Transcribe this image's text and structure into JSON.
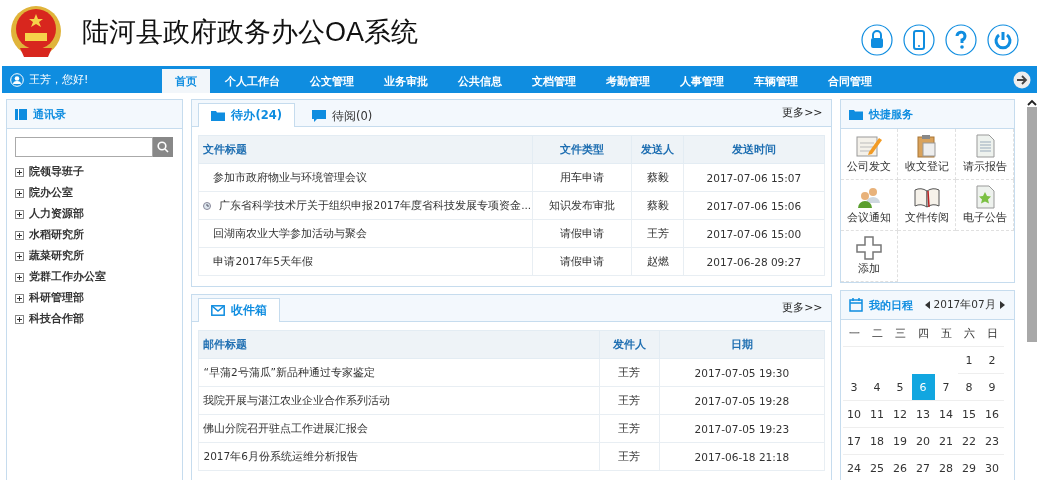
{
  "header": {
    "title": "陆河县政府政务办公OA系统"
  },
  "nav": {
    "greeting": "王芳，您好!",
    "items": [
      {
        "label": "首页",
        "selected": true
      },
      {
        "label": "个人工作台",
        "selected": false
      },
      {
        "label": "公文管理",
        "selected": false
      },
      {
        "label": "业务审批",
        "selected": false
      },
      {
        "label": "公共信息",
        "selected": false
      },
      {
        "label": "文档管理",
        "selected": false
      },
      {
        "label": "考勤管理",
        "selected": false
      },
      {
        "label": "人事管理",
        "selected": false
      },
      {
        "label": "车辆管理",
        "selected": false
      },
      {
        "label": "合同管理",
        "selected": false
      }
    ]
  },
  "contacts": {
    "title": "通讯录",
    "groups": [
      {
        "label": "院领导班子",
        "expanded": false
      },
      {
        "label": "院办公室",
        "expanded": false
      },
      {
        "label": "人力资源部",
        "expanded": false
      },
      {
        "label": "水稻研究所",
        "expanded": false
      },
      {
        "label": "蔬菜研究所",
        "expanded": false
      },
      {
        "label": "党群工作办公室",
        "expanded": false
      },
      {
        "label": "科研管理部",
        "expanded": false
      },
      {
        "label": "科技合作部",
        "expanded": false
      }
    ]
  },
  "tasks": {
    "tabs": [
      {
        "label": "待办(24)",
        "selected": true
      },
      {
        "label": "待阅(0)",
        "selected": false
      }
    ],
    "more": "更多>>",
    "columns": [
      "文件标题",
      "文件类型",
      "发送人",
      "发送时间"
    ],
    "rows": [
      {
        "cells": [
          "参加市政府物业与环境管理会议",
          "用车申请",
          "蔡毅",
          "2017-07-06 15:07"
        ],
        "marked": false
      },
      {
        "cells": [
          "广东省科学技术厅关于组织申报2017年度省科技发展专项资金...",
          "知识发布审批",
          "蔡毅",
          "2017-07-06 15:06"
        ],
        "marked": true
      },
      {
        "cells": [
          "回湖南农业大学参加活动与聚会",
          "请假申请",
          "王芳",
          "2017-07-06 15:00"
        ],
        "marked": false
      },
      {
        "cells": [
          "申请2017年5天年假",
          "请假申请",
          "赵燃",
          "2017-06-28 09:27"
        ],
        "marked": false
      }
    ]
  },
  "inbox": {
    "tabs": [
      {
        "label": "收件箱",
        "selected": true
      }
    ],
    "more": "更多>>",
    "columns": [
      "邮件标题",
      "发件人",
      "日期"
    ],
    "rows": [
      {
        "cells": [
          "“早蒲2号蒲瓜”新品种通过专家鉴定",
          "王芳",
          "2017-07-05 19:30"
        ]
      },
      {
        "cells": [
          "我院开展与湛江农业企业合作系列活动",
          "王芳",
          "2017-07-05 19:28"
        ]
      },
      {
        "cells": [
          "佛山分院召开驻点工作进展汇报会",
          "王芳",
          "2017-07-05 19:23"
        ]
      },
      {
        "cells": [
          "2017年6月份系统运维分析报告",
          "王芳",
          "2017-06-18 21:18"
        ]
      }
    ]
  },
  "quick_services": {
    "title": "快捷服务",
    "items": [
      {
        "label": "公司发文",
        "kind": "notepad"
      },
      {
        "label": "收文登记",
        "kind": "clipboard"
      },
      {
        "label": "请示报告",
        "kind": "document"
      },
      {
        "label": "会议通知",
        "kind": "people"
      },
      {
        "label": "文件传阅",
        "kind": "book"
      },
      {
        "label": "电子公告",
        "kind": "star"
      },
      {
        "label": "添加",
        "kind": "plus"
      }
    ]
  },
  "schedule": {
    "title": "我的日程",
    "month": "2017年07月",
    "weekdays": [
      "一",
      "二",
      "三",
      "四",
      "五",
      "六",
      "日"
    ],
    "weeks": [
      {
        "days": [
          {
            "label": "1",
            "selected": false
          },
          {
            "label": "2",
            "selected": false
          }
        ]
      },
      {
        "days": [
          {
            "label": "3",
            "selected": false
          },
          {
            "label": "4",
            "selected": false
          },
          {
            "label": "5",
            "selected": false
          },
          {
            "label": "6",
            "selected": true
          },
          {
            "label": "7",
            "selected": false
          },
          {
            "label": "8",
            "selected": false
          },
          {
            "label": "9",
            "selected": false
          }
        ]
      },
      {
        "days": [
          {
            "label": "10",
            "selected": false
          },
          {
            "label": "11",
            "selected": false
          },
          {
            "label": "12",
            "selected": false
          },
          {
            "label": "13",
            "selected": false
          },
          {
            "label": "14",
            "selected": false
          },
          {
            "label": "15",
            "selected": false
          },
          {
            "label": "16",
            "selected": false
          }
        ]
      },
      {
        "days": [
          {
            "label": "17",
            "selected": false
          },
          {
            "label": "18",
            "selected": false
          },
          {
            "label": "19",
            "selected": false
          },
          {
            "label": "20",
            "selected": false
          },
          {
            "label": "21",
            "selected": false
          },
          {
            "label": "22",
            "selected": false
          },
          {
            "label": "23",
            "selected": false
          }
        ]
      },
      {
        "days": [
          {
            "label": "24",
            "selected": false
          },
          {
            "label": "25",
            "selected": false
          },
          {
            "label": "26",
            "selected": false
          },
          {
            "label": "27",
            "selected": false
          },
          {
            "label": "28",
            "selected": false
          },
          {
            "label": "29",
            "selected": false
          },
          {
            "label": "30",
            "selected": false
          }
        ]
      }
    ]
  }
}
